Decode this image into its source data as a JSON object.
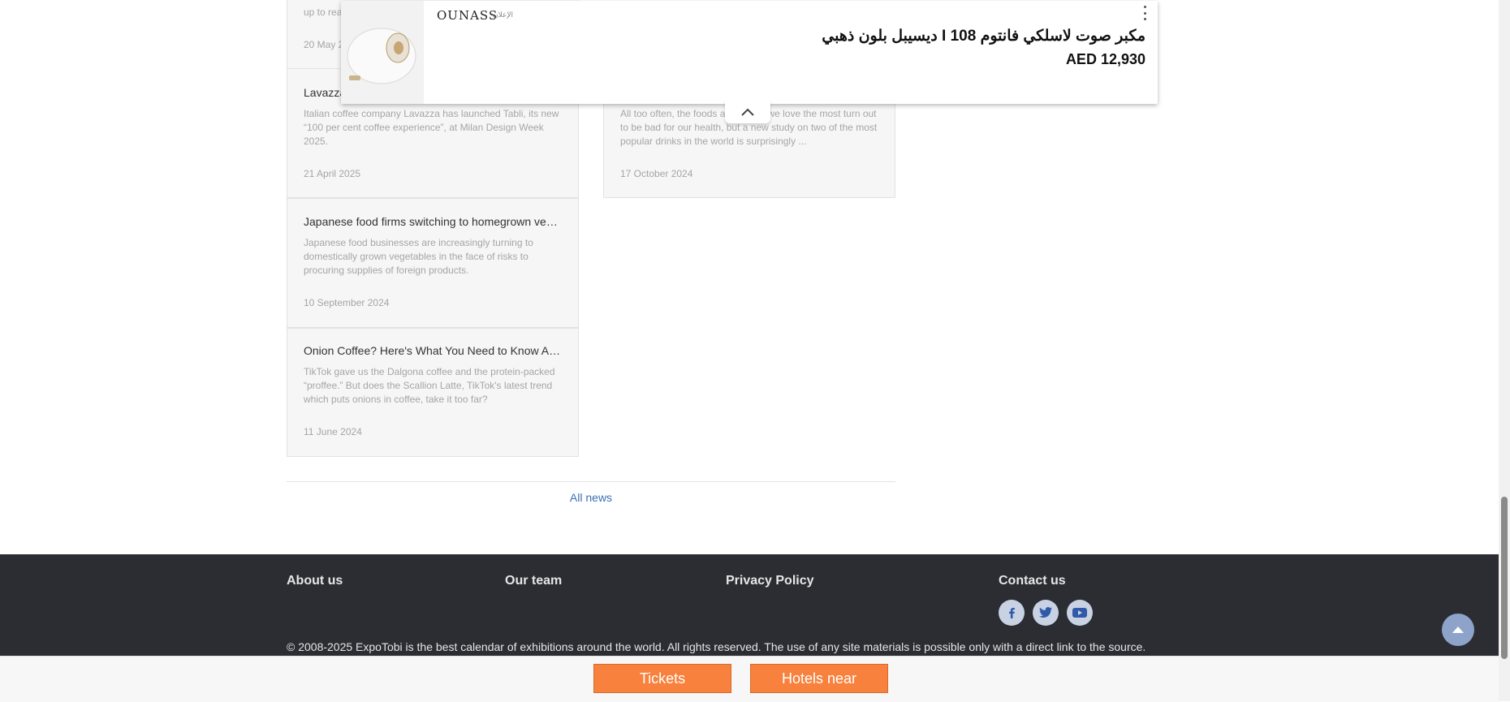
{
  "cards": [
    {
      "title": "",
      "desc": "up to rea",
      "date": "20 May 2"
    },
    {
      "title": "Lavazza",
      "desc": "Italian coffee company Lavazza has launched Tabli, its new “100 per cent coffee experience”, at Milan Design Week 2025.",
      "date": "21 April 2025"
    },
    {
      "title": "",
      "desc": "All too often, the foods and drinks we love the most turn out to be bad for our health, but a new study on two of the most popular drinks in the world is surprisingly ...",
      "date": "17 October 2024"
    },
    {
      "title": "Japanese food firms switching to homegrown vegetables",
      "desc": "Japanese food businesses are increasingly turning to domestically grown vegetables in the face of risks to procuring supplies of foreign products.",
      "date": "10 September 2024"
    },
    {
      "title": "Onion Coffee? Here's What You Need to Know About Scallion Latte",
      "desc": "TikTok gave us the Dalgona coffee and the protein-packed “proffee.” But does the Scallion Latte, TikTok's latest trend which puts onions in coffee, take it too far?",
      "date": "11 June 2024"
    }
  ],
  "all_news": "All news",
  "ad": {
    "brand": "OUNASS",
    "ad_label": "الإعلان",
    "title": "مكبر صوت لاسلكي فانتوم I 108 ديسيبل بلون ذهبي",
    "price": "AED 12,930"
  },
  "footer": {
    "links": [
      "About us",
      "Our team",
      "Privacy Policy",
      "Contact us"
    ],
    "copyright": "© 2008-2025 ExpoTobi is the best calendar of exhibitions around the world. All rights reserved. The use of any site materials is possible only with a direct link to the source."
  },
  "buttons": {
    "tickets": "Tickets",
    "hotels": "Hotels near"
  },
  "colors": {
    "accent": "#f7813d",
    "footer_bg": "#2b2d33",
    "link": "#3b6fb6"
  }
}
